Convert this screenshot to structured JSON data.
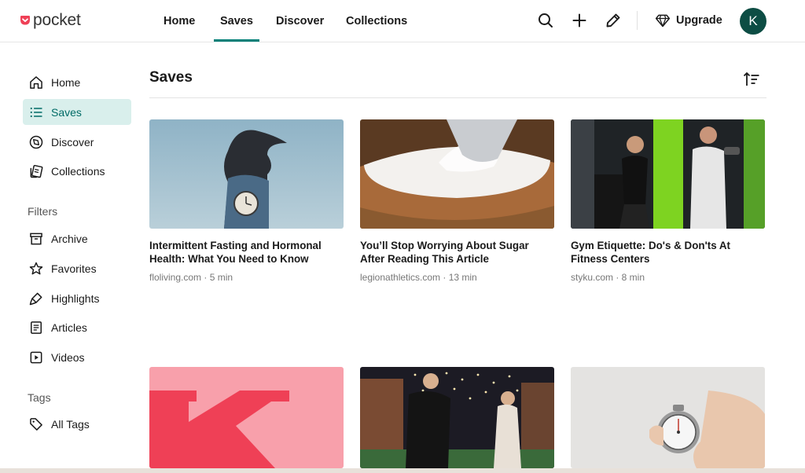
{
  "brand": {
    "name": "pocket",
    "color": "#ef4056"
  },
  "nav": {
    "tabs": [
      {
        "label": "Home"
      },
      {
        "label": "Saves"
      },
      {
        "label": "Discover"
      },
      {
        "label": "Collections"
      }
    ],
    "active": "Saves",
    "upgrade_label": "Upgrade",
    "avatar_initial": "K",
    "accent": "#008078"
  },
  "sidebar": {
    "items": [
      {
        "label": "Home",
        "icon": "home-icon"
      },
      {
        "label": "Saves",
        "icon": "list-icon"
      },
      {
        "label": "Discover",
        "icon": "compass-icon"
      },
      {
        "label": "Collections",
        "icon": "collections-icon"
      }
    ],
    "filters_heading": "Filters",
    "filters": [
      {
        "label": "Archive",
        "icon": "archive-icon"
      },
      {
        "label": "Favorites",
        "icon": "star-icon"
      },
      {
        "label": "Highlights",
        "icon": "highlighter-icon"
      },
      {
        "label": "Articles",
        "icon": "article-icon"
      },
      {
        "label": "Videos",
        "icon": "video-icon"
      }
    ],
    "tags_heading": "Tags",
    "tags": [
      {
        "label": "All Tags",
        "icon": "tag-icon"
      }
    ]
  },
  "main": {
    "title": "Saves",
    "cards": [
      {
        "title": "Intermittent Fasting and Hormonal Health: What You Need to Know",
        "meta": "floliving.com · 5 min",
        "image": "woman-holding-clock"
      },
      {
        "title": "You’ll Stop Worrying About Sugar After Reading This Article",
        "meta": "legionathletics.com · 13 min",
        "image": "bowl-of-sugar"
      },
      {
        "title": "Gym Etiquette: Do's & Don'ts At Fitness Centers",
        "meta": "styku.com · 8 min",
        "image": "gym-couple"
      },
      {
        "title": "",
        "meta": "",
        "image": "red-k-letter"
      },
      {
        "title": "",
        "meta": "",
        "image": "wedding-couple-lights"
      },
      {
        "title": "",
        "meta": "",
        "image": "hand-stopwatch"
      }
    ]
  }
}
